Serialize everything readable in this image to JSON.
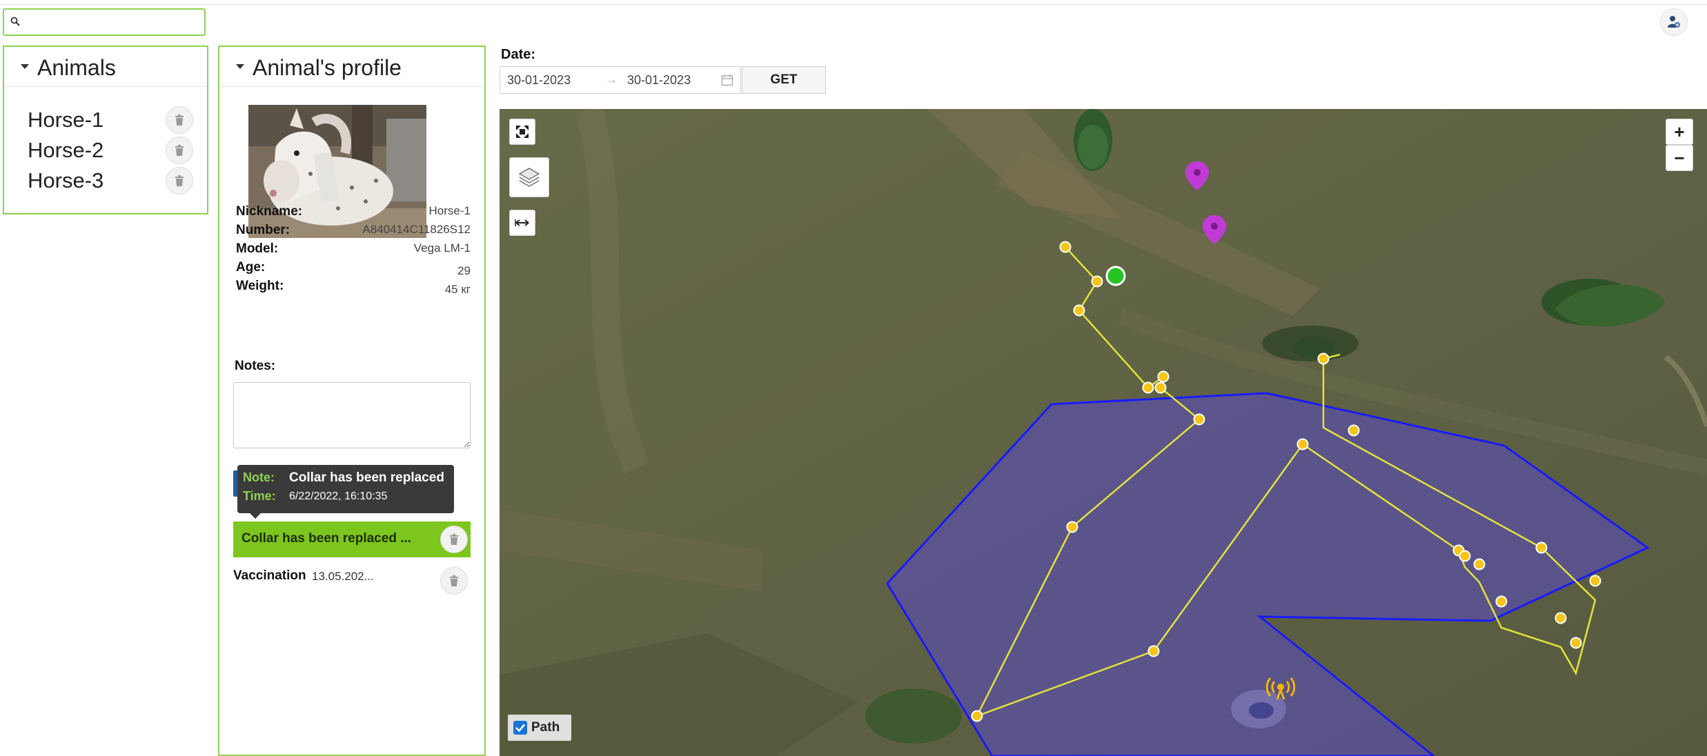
{
  "search": {
    "placeholder": "",
    "value": ""
  },
  "header": {
    "user_icon": "user-settings-icon"
  },
  "animals_panel": {
    "title": "Animals",
    "items": [
      {
        "label": "Horse-1"
      },
      {
        "label": "Horse-2"
      },
      {
        "label": "Horse-3"
      }
    ]
  },
  "profile_panel": {
    "title": "Animal's profile",
    "photo": "white spotted pony photo",
    "fields": [
      {
        "label": "Nickname:",
        "value": "Horse-1"
      },
      {
        "label": "Number:",
        "value": "A840414C11826S12"
      },
      {
        "label": "Model:",
        "value": "Vega LM-1"
      },
      {
        "label": "Age:",
        "value": "29"
      },
      {
        "label": "Weight:",
        "value": "45 кг"
      }
    ],
    "notes_label": "Notes:",
    "notes_value": "",
    "tooltip": {
      "note_key": "Note:",
      "note_value": "Collar has been replaced",
      "time_key": "Time:",
      "time_value": "6/22/2022, 16:10:35"
    },
    "notes": [
      {
        "title": "Collar has been replaced ...",
        "date": "",
        "active": true
      },
      {
        "title": "Vaccination",
        "date": "13.05.202...",
        "active": false
      }
    ]
  },
  "date_filter": {
    "label": "Date:",
    "start": "30-01-2023",
    "end": "30-01-2023",
    "separator": "→",
    "get_label": "GET"
  },
  "map": {
    "zoom_in_label": "+",
    "zoom_out_label": "−",
    "path_label": "Path",
    "path_checked": true,
    "colors": {
      "geofence_stroke": "#1a1aff",
      "geofence_fill": "#5a4cc0",
      "track": "#e3e33a",
      "point": "#f5c518",
      "current_position": "#22c522",
      "pin": "#c23ad6",
      "tower": "#f2b400"
    },
    "icons": [
      "fullscreen-icon",
      "layers-icon",
      "measure-icon",
      "map-pin-icon",
      "radio-tower-icon"
    ]
  }
}
